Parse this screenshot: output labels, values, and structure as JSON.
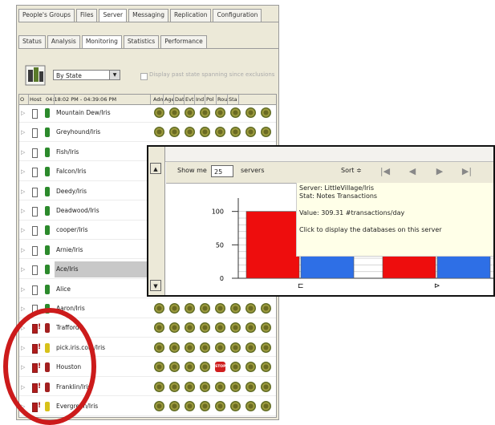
{
  "tabs_top": [
    "People's Groups",
    "Files",
    "Server",
    "Messaging",
    "Replication",
    "Configuration"
  ],
  "tabs_sub": [
    "Status",
    "Analysis",
    "Monitoring",
    "Statistics",
    "Performance"
  ],
  "toolbar": {
    "combo_value": "By State",
    "checkbox_label": "Display past state spanning since exclusions"
  },
  "grid": {
    "headers": [
      "O",
      "Host",
      "04:18:02 PM - 04:39:06 PM",
      "Adm",
      "Age",
      "Dat",
      "Evt",
      "Ind",
      "Pol",
      "Rou",
      "Sta"
    ],
    "rows": [
      {
        "name": "Mountain Dew/Iris",
        "status": "ok",
        "icon": "green",
        "flowers": [
          "f",
          "f",
          "f",
          "f",
          "f",
          "f",
          "f",
          "f"
        ]
      },
      {
        "name": "Greyhound/Iris",
        "status": "ok",
        "icon": "green",
        "flowers": [
          "f",
          "f",
          "f",
          "f",
          "f",
          "f",
          "f",
          "f"
        ]
      },
      {
        "name": "Fish/Iris",
        "status": "ok",
        "icon": "green",
        "flowers": [
          "f",
          "f",
          "f",
          "f",
          "f",
          "f",
          "f",
          "f"
        ]
      },
      {
        "name": "Falcon/Iris",
        "status": "ok",
        "icon": "green",
        "flowers": [
          "f",
          "f",
          "f",
          "f",
          "f",
          "f",
          "f",
          "f"
        ]
      },
      {
        "name": "Deedy/Iris",
        "status": "ok",
        "icon": "green",
        "flowers": [
          "f",
          "f",
          "f",
          "f",
          "f",
          "f",
          "f",
          "f"
        ]
      },
      {
        "name": "Deadwood/Iris",
        "status": "ok",
        "icon": "green",
        "flowers": [
          "f",
          "f",
          "f",
          "f",
          "f",
          "f",
          "f",
          "f"
        ]
      },
      {
        "name": "cooper/Iris",
        "status": "ok",
        "icon": "green",
        "flowers": [
          "f",
          "f",
          "f",
          "f",
          "f",
          "f",
          "f",
          "f"
        ]
      },
      {
        "name": "Arnie/Iris",
        "status": "ok",
        "icon": "green",
        "flowers": [
          "f",
          "f",
          "f",
          "f",
          "f",
          "f",
          "f",
          "f"
        ]
      },
      {
        "name": "Ace/Iris",
        "status": "ok",
        "icon": "green",
        "flowers": [
          "f",
          "f",
          "f",
          "f",
          "f",
          "f",
          "f",
          "f"
        ]
      },
      {
        "name": "Alice",
        "status": "ok",
        "icon": "green",
        "flowers": [
          "f",
          "f",
          "f",
          "f",
          "f",
          "f",
          "f",
          "f"
        ]
      },
      {
        "name": "Aaron/Iris",
        "status": "ok",
        "icon": "green",
        "flowers": [
          "f",
          "f",
          "f",
          "f",
          "f",
          "f",
          "f",
          "f"
        ]
      },
      {
        "name": "Trafford",
        "status": "bad",
        "icon": "red",
        "flowers": [
          "f",
          "f",
          "f",
          "f",
          "f",
          "f",
          "f",
          "f"
        ]
      },
      {
        "name": "pick.iris.com/Iris",
        "status": "bad",
        "icon": "yellow",
        "flowers": [
          "f",
          "f",
          "f",
          "f",
          "f",
          "f",
          "f",
          "f"
        ]
      },
      {
        "name": "Houston",
        "status": "bad",
        "icon": "red",
        "flowers": [
          "f",
          "f",
          "f",
          "f",
          "stop",
          "f",
          "f",
          "f"
        ]
      },
      {
        "name": "Franklin/Iris",
        "status": "bad",
        "icon": "red",
        "flowers": [
          "f",
          "f",
          "f",
          "f",
          "f",
          "f",
          "f",
          "f"
        ]
      },
      {
        "name": "Evergreen/Iris",
        "status": "bad",
        "icon": "yellow",
        "flowers": [
          "f",
          "f",
          "f",
          "f",
          "f",
          "f",
          "f",
          "f"
        ]
      }
    ],
    "selected_row": 8
  },
  "stop_label": "STOP",
  "popup": {
    "show_me_label": "Show me",
    "count": "25",
    "servers_label": "servers",
    "sort_label": "Sort ≑",
    "nav_icons": [
      "first-icon",
      "prev-icon",
      "next-icon",
      "last-icon"
    ],
    "tooltip": {
      "line1": "Server: LittleVillage/Iris",
      "line2": "Stat: Notes Transactions",
      "line3": "Value: 309.31 #transactions/day",
      "line4": "Click to display the databases on this server"
    }
  },
  "chart_data": {
    "type": "bar",
    "yticks": [
      0,
      50,
      100
    ],
    "ylim": [
      0,
      120
    ],
    "series": [
      {
        "color": "#ee0d0d",
        "values": [
          100,
          36
        ]
      },
      {
        "color": "#2e6fe6",
        "values": [
          36,
          52
        ]
      }
    ],
    "category_markers": [
      "⊏",
      "⊳"
    ]
  },
  "colors": {
    "annotation_ring": "#cc1b1b"
  }
}
